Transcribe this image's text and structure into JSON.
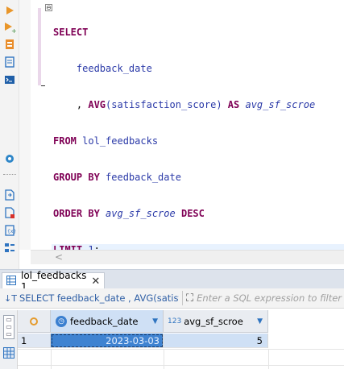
{
  "toolbar": {
    "icons": [
      "execute-icon",
      "execute-script-icon",
      "explain-plan-icon",
      "load-script-icon",
      "console-icon",
      "settings-icon",
      "export-icon",
      "new-script-icon",
      "variables-icon",
      "outline-icon"
    ]
  },
  "editor": {
    "fold_symbol": "⊖",
    "sql": {
      "l1_select": "SELECT",
      "l2_col": "feedback_date",
      "l3_comma": ", ",
      "l3_func": "AVG",
      "l3_arg": "(satisfaction_score)",
      "l3_as": "AS",
      "l3_alias": "avg_sf_scroe",
      "l4_from": "FROM",
      "l4_table": "lol_feedbacks",
      "l5_group": "GROUP BY",
      "l5_col": "feedback_date",
      "l6_order": "ORDER BY",
      "l6_alias": "avg_sf_scroe",
      "l6_desc": "DESC",
      "l7_limit": "LIMIT",
      "l7_num": "1",
      "l7_semi": ";"
    },
    "scroll_left_arrow": "<"
  },
  "results": {
    "tab_label": "lol_feedbacks 1",
    "tab_close": "✕",
    "filter_sql": "SELECT feedback_date , AVG(satisfac",
    "filter_placeholder": "Enter a SQL expression to filter results (use Ctrl+Space)",
    "columns": [
      {
        "type_badge": "🕓",
        "name": "feedback_date"
      },
      {
        "type_badge": "123",
        "name": "avg_sf_scroe"
      }
    ],
    "rows": [
      {
        "num": "1",
        "feedback_date": "2023-03-03",
        "avg_sf_scroe": "5"
      }
    ],
    "colors": {
      "keyword": "#7f0055",
      "identifier": "#2b3aa8",
      "selected_cell": "#3f83d1",
      "header_selected": "#cfe0f5"
    }
  }
}
